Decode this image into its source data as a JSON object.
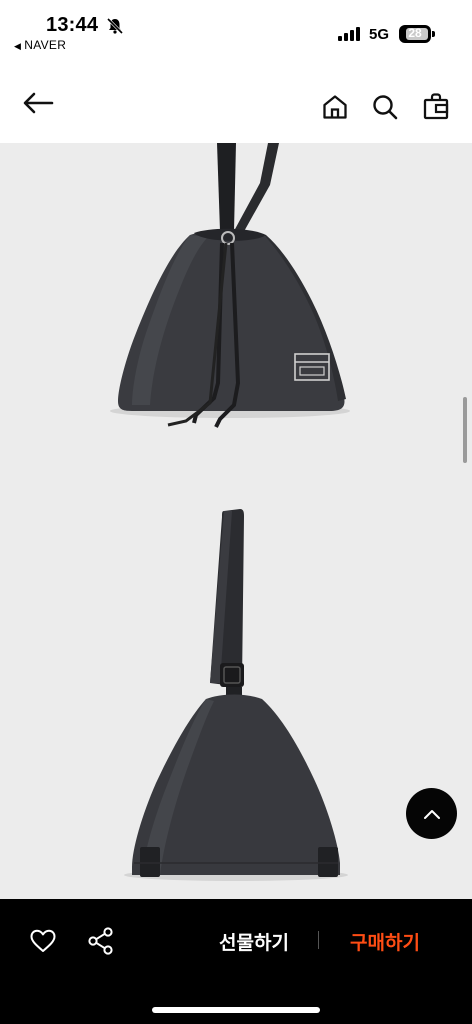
{
  "status_bar": {
    "time": "13:44",
    "back_app_label": "NAVER",
    "network": "5G",
    "battery_level": "28"
  },
  "nav": {
    "icons": [
      "back-arrow-icon",
      "home-icon",
      "search-icon",
      "shopping-bag-icon"
    ]
  },
  "product": {
    "images": [
      "drawstring-bag-front-view",
      "drawstring-bag-side-view"
    ],
    "background_color": "#ececec"
  },
  "bottom_bar": {
    "gift_label": "선물하기",
    "buy_label": "구매하기",
    "buy_color": "#ff4d14",
    "icons": [
      "heart-icon",
      "share-icon"
    ]
  }
}
